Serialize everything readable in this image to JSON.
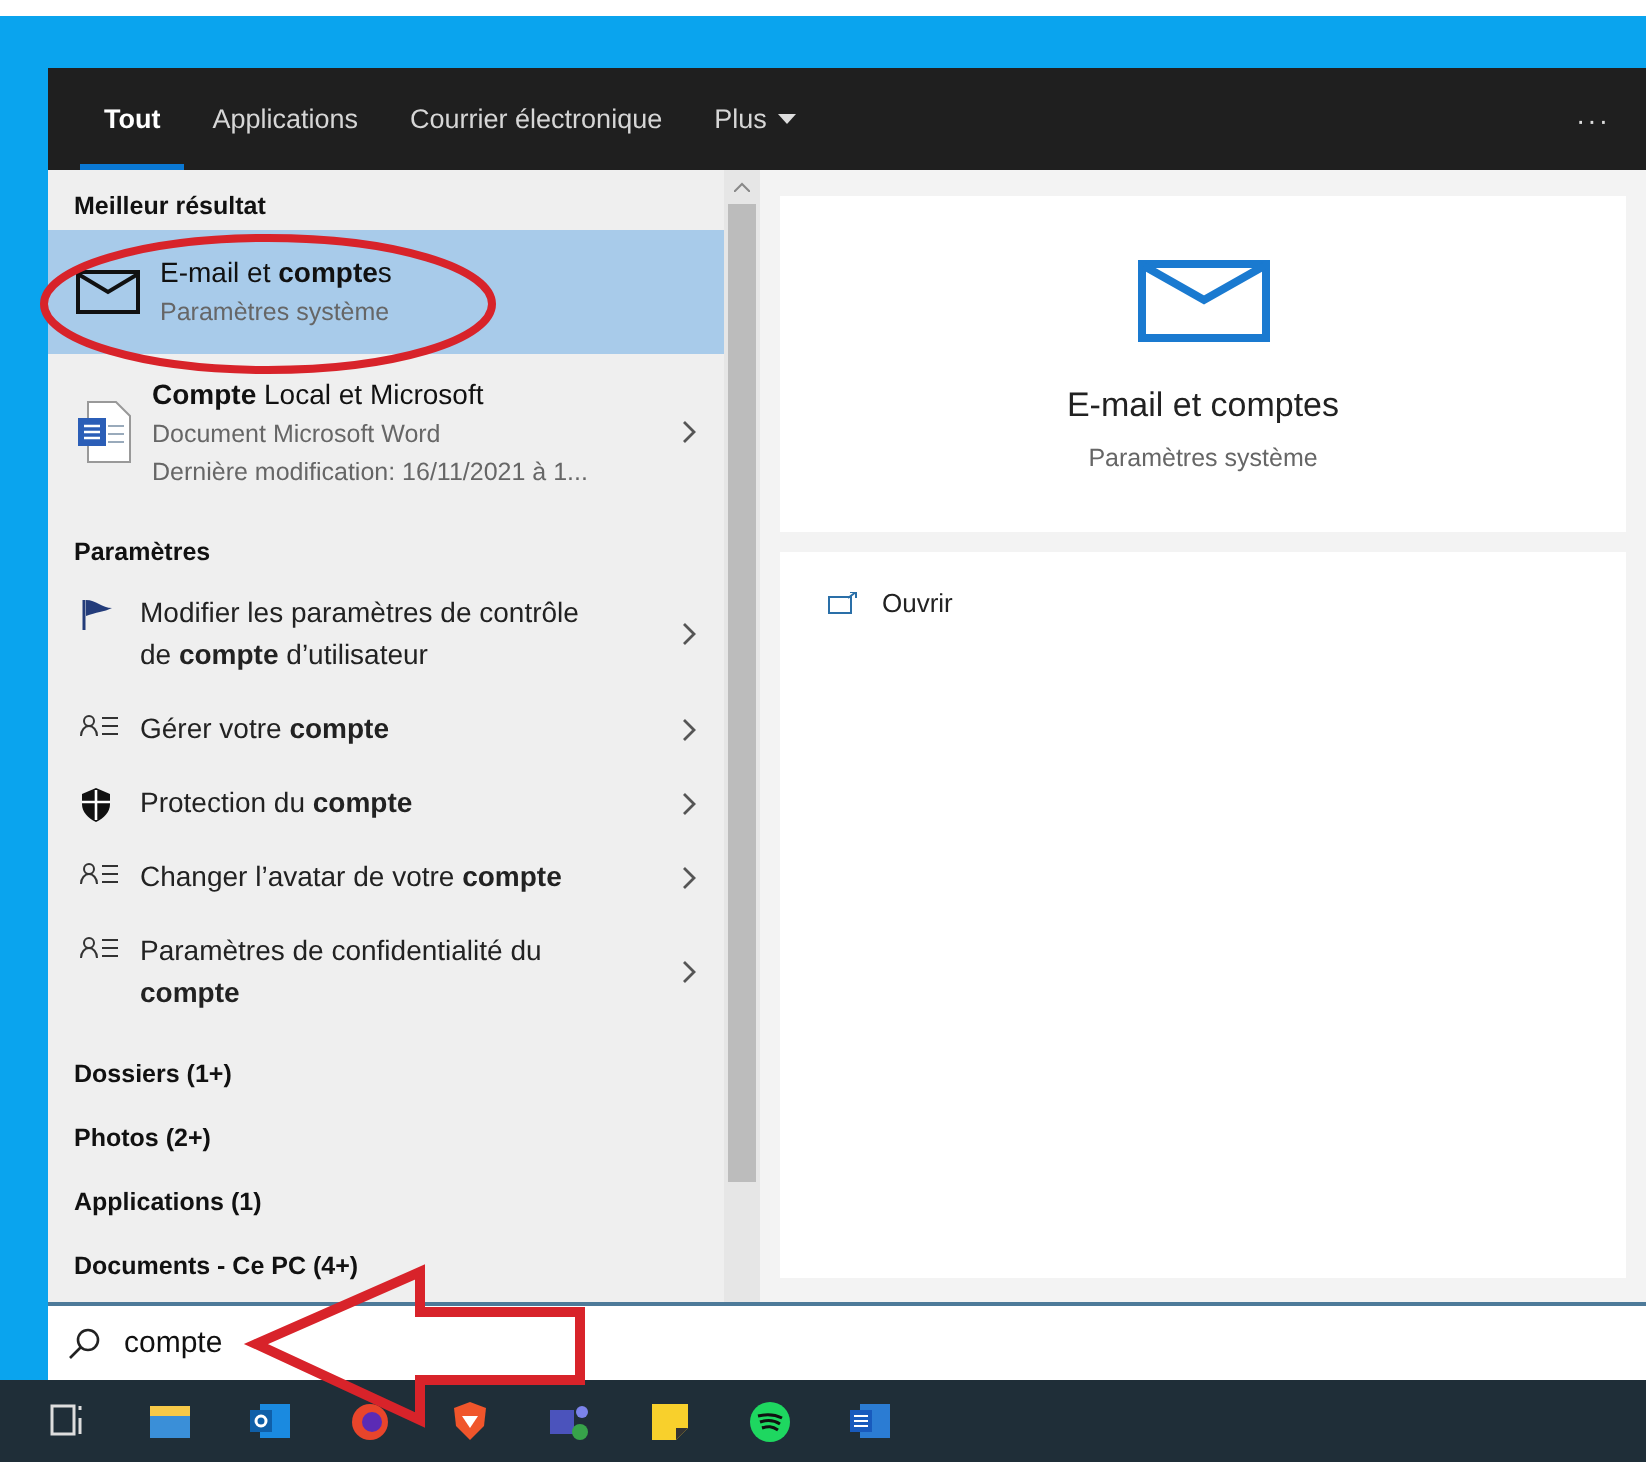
{
  "tabs": [
    {
      "label": "Tout",
      "selected": true,
      "has_menu": false
    },
    {
      "label": "Applications",
      "selected": false,
      "has_menu": false
    },
    {
      "label": "Courrier électronique",
      "selected": false,
      "has_menu": false
    },
    {
      "label": "Plus",
      "selected": false,
      "has_menu": true
    }
  ],
  "more_button": "···",
  "best_match": {
    "heading": "Meilleur résultat",
    "items": [
      {
        "kind": "mail",
        "title": "E-mail et **compte**s",
        "subtitle": "Paramètres système",
        "selected": true,
        "has_arrow": false
      },
      {
        "kind": "word",
        "title": "**Compte** Local et Microsoft",
        "subtitle": "Document Microsoft Word",
        "detail": "Dernière modification: 16/11/2021 à 1...",
        "selected": false,
        "has_arrow": true
      }
    ]
  },
  "settings": {
    "heading": "Paramètres",
    "items": [
      {
        "kind": "flag",
        "label": "Modifier les paramètres de contrôle de **compte** d’utilisateur"
      },
      {
        "kind": "person-list",
        "label": "Gérer votre **compte**"
      },
      {
        "kind": "shield",
        "label": "Protection du **compte**"
      },
      {
        "kind": "person-list",
        "label": "Changer l’avatar de votre **compte**"
      },
      {
        "kind": "person-list",
        "label": "Paramètres de confidentialité du **compte**"
      }
    ]
  },
  "categories": [
    "Dossiers (1+)",
    "Photos (2+)",
    "Applications (1)",
    "Documents - Ce PC (4+)"
  ],
  "preview": {
    "title": "E-mail et comptes",
    "subtitle": "Paramètres système",
    "actions": [
      {
        "label": "Ouvrir"
      }
    ]
  },
  "search": {
    "value": "compte"
  }
}
